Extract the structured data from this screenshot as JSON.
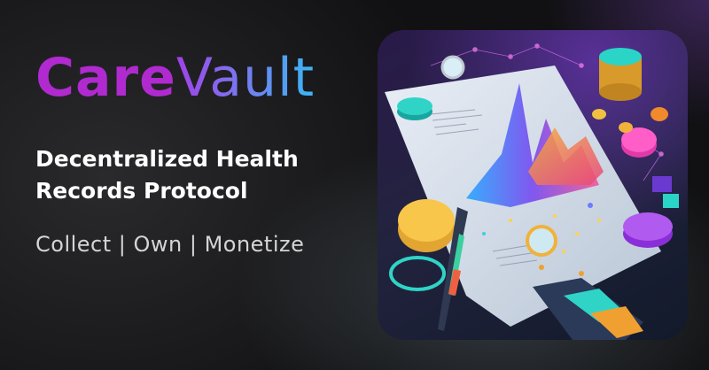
{
  "brand": {
    "part1": "Care",
    "part2": "Vault"
  },
  "tagline": {
    "line1": "Decentralized Health",
    "line2": "Records Protocol"
  },
  "subline": "Collect | Own | Monetize",
  "colors": {
    "care": "#b02ad0",
    "vault_start": "#a043e8",
    "vault_end": "#39b8f5",
    "background": "#1a1a1c"
  }
}
